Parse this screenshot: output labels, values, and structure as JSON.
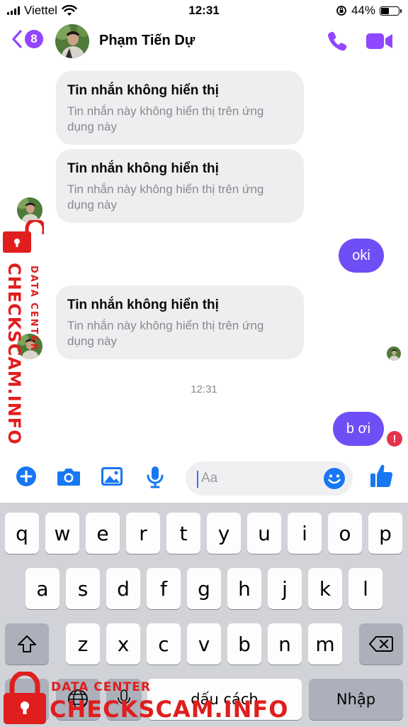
{
  "status": {
    "carrier": "Viettel",
    "time": "12:31",
    "battery": "44%",
    "battery_level": 0.44
  },
  "header": {
    "back_count": "8",
    "contact_name": "Phạm Tiến Dự",
    "call_icon": "phone-icon",
    "video_icon": "video-camera-icon"
  },
  "messages": {
    "unseen": [
      {
        "title": "Tin nhắn không hiển thị",
        "desc": "Tin nhắn này không hiển thị trên ứng dụng này"
      },
      {
        "title": "Tin nhắn không hiển thị",
        "desc": "Tin nhắn này không hiển thị trên ứng dụng này"
      },
      {
        "title": "Tin nhắn không hiển thị",
        "desc": "Tin nhắn này không hiển thị trên ứng dụng này"
      }
    ],
    "out_1": "oki",
    "timestamp": "12:31",
    "out_2": "b ơi",
    "error_mark": "!"
  },
  "watermark": {
    "line1": "DATA CENTER",
    "line2": "CHECKSCAM.INFO"
  },
  "composer": {
    "placeholder": "Aa"
  },
  "keyboard": {
    "row1": [
      "q",
      "w",
      "e",
      "r",
      "t",
      "y",
      "u",
      "i",
      "o",
      "p"
    ],
    "row2": [
      "a",
      "s",
      "d",
      "f",
      "g",
      "h",
      "j",
      "k",
      "l"
    ],
    "row3": [
      "z",
      "x",
      "c",
      "v",
      "b",
      "n",
      "m"
    ],
    "space": "dấu cách",
    "return": "Nhập"
  },
  "colors": {
    "accent": "#9146ff",
    "bubble_out": "#6f4ef5",
    "icon_blue": "#1877f2",
    "watermark_red": "#e01e1e"
  }
}
